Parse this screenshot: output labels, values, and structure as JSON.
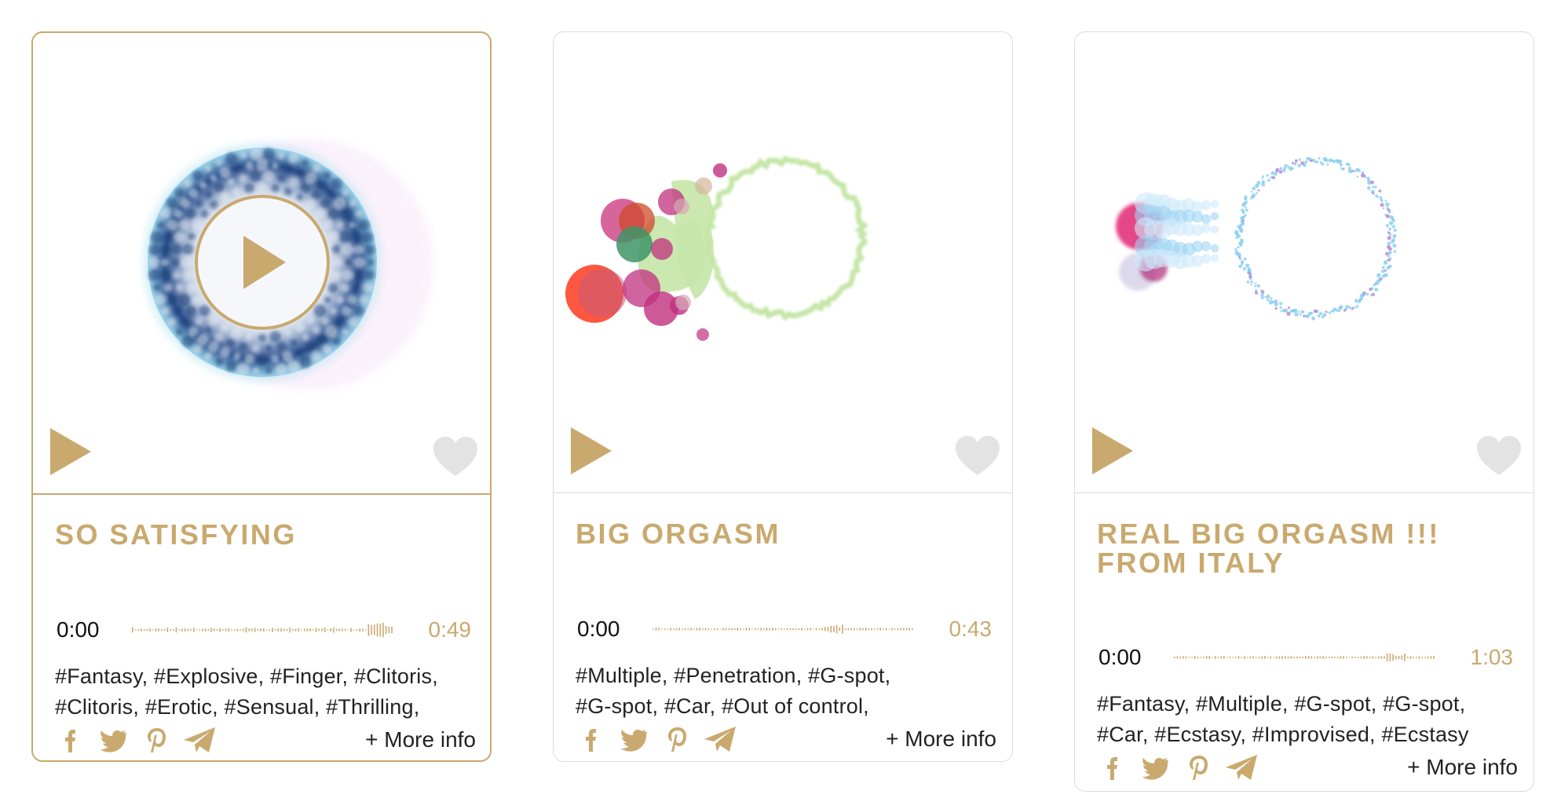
{
  "accent_color": "#c9a96e",
  "cards": [
    {
      "title": "SO SATISFYING",
      "time_current": "0:00",
      "duration": "0:49",
      "tags": [
        "#Fantasy, #Explosive, #Finger, #Clitoris,",
        "#Clitoris, #Erotic, #Sensual, #Thrilling,"
      ],
      "more_info": "+ More info",
      "active": true,
      "visual": "blue-ring",
      "icons": [
        "play-icon",
        "heart-icon",
        "facebook-icon",
        "twitter-icon",
        "pinterest-icon",
        "telegram-icon"
      ]
    },
    {
      "title": "BIG ORGASM",
      "time_current": "0:00",
      "duration": "0:43",
      "tags": [
        "#Multiple, #Penetration, #G-spot,",
        "#G-spot, #Car, #Out of control,"
      ],
      "more_info": "+ More info",
      "active": false,
      "visual": "green-ring",
      "icons": [
        "play-icon",
        "heart-icon",
        "facebook-icon",
        "twitter-icon",
        "pinterest-icon",
        "telegram-icon"
      ]
    },
    {
      "title": "REAL BIG ORGASM !!! FROM ITALY",
      "title_lines": [
        "REAL BIG ORGASM !!!",
        "FROM ITALY"
      ],
      "time_current": "0:00",
      "duration": "1:03",
      "tags": [
        "#Fantasy, #Multiple, #G-spot, #G-spot,",
        "#Car, #Ecstasy, #Improvised, #Ecstasy"
      ],
      "more_info": "+ More info",
      "active": false,
      "visual": "blue-dotted-ring",
      "icons": [
        "play-icon",
        "heart-icon",
        "facebook-icon",
        "twitter-icon",
        "pinterest-icon",
        "telegram-icon"
      ]
    }
  ]
}
